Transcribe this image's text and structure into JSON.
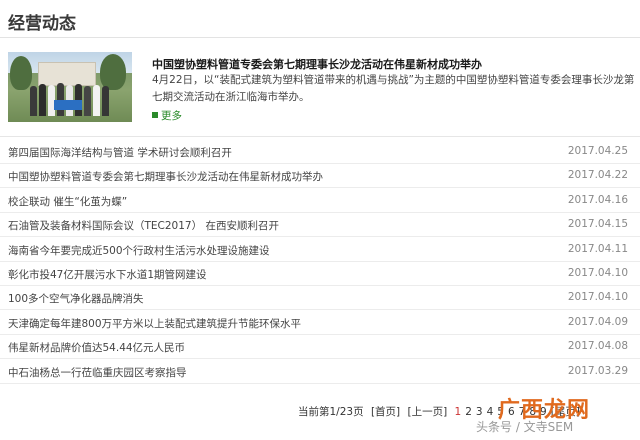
{
  "section": {
    "title": "经营动态"
  },
  "featured": {
    "title": "中国塑协塑料管道专委会第七期理事长沙龙活动在伟星新材成功举办",
    "description": "4月22日，以“装配式建筑为塑料管道带来的机遇与挑战”为主题的中国塑协塑料管道专委会理事长沙龙第七期交流活动在浙江临海市举办。",
    "more_label": "更多"
  },
  "news": [
    {
      "title": "第四届国际海洋结构与管道 学术研讨会顺利召开",
      "date": "2017.04.25"
    },
    {
      "title": "中国塑协塑料管道专委会第七期理事长沙龙活动在伟星新材成功举办",
      "date": "2017.04.22"
    },
    {
      "title": "校企联动 催生“化茧为蝶”",
      "date": "2017.04.16"
    },
    {
      "title": "石油管及装备材料国际会议（TEC2017） 在西安顺利召开",
      "date": "2017.04.15"
    },
    {
      "title": "海南省今年要完成近500个行政村生活污水处理设施建设",
      "date": "2017.04.11"
    },
    {
      "title": "彰化市投47亿开展污水下水道1期管网建设",
      "date": "2017.04.10"
    },
    {
      "title": "100多个空气净化器品牌消失",
      "date": "2017.04.10"
    },
    {
      "title": "天津确定每年建800万平方米以上装配式建筑提升节能环保水平",
      "date": "2017.04.09"
    },
    {
      "title": "伟星新材品牌价值达54.44亿元人民币",
      "date": "2017.04.08"
    },
    {
      "title": "中石油杨总一行莅临重庆园区考察指导",
      "date": "2017.03.29"
    }
  ],
  "pagination": {
    "status": "当前第1/23页",
    "first": "[首页]",
    "prev": "[上一页]",
    "pages": [
      "1",
      "2",
      "3",
      "4",
      "5",
      "6",
      "7",
      "8",
      "9"
    ],
    "last": "[尾页]"
  },
  "watermark": {
    "line1": "广西龙网",
    "line2": "头条号 / 文寺SEM"
  },
  "colors": {
    "accent": "#2a8a2a",
    "active_page": "#cc3333",
    "watermark": "#e06a1e"
  }
}
